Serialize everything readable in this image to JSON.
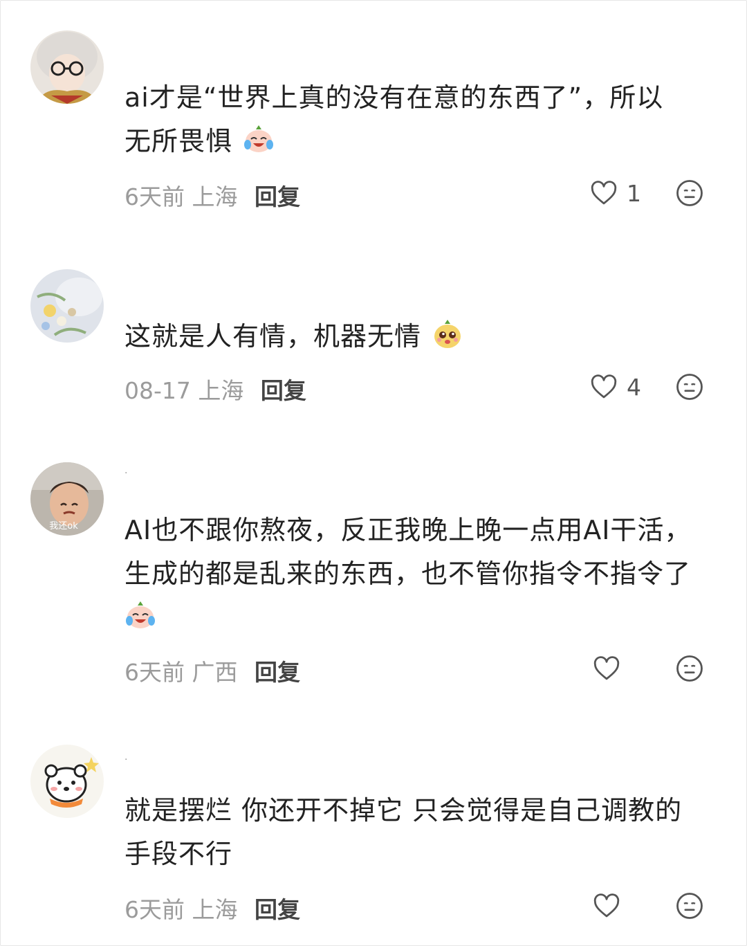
{
  "comments": [
    {
      "username": "",
      "text_lines": [
        "ai才是“世界上真的没有在意的东西了”，所以",
        "无所畏惧"
      ],
      "time": "6天前",
      "location": "上海",
      "reply_label": "回复",
      "likes": "1",
      "emoji_icon": "crying-laughing-emoji-icon"
    },
    {
      "username": "",
      "text_lines": [
        "这就是人有情，机器无情"
      ],
      "time": "08-17",
      "location": "上海",
      "reply_label": "回复",
      "likes": "4",
      "emoji_icon": "puppy-eyes-emoji-icon"
    },
    {
      "username": ".",
      "avatar_text": "我还ok",
      "text_lines": [
        "AI也不跟你熬夜，反正我晚上晚一点用AI干活，",
        "生成的都是乱来的东西，也不管你指令不指令了"
      ],
      "time": "6天前",
      "location": "广西",
      "reply_label": "回复",
      "likes": "",
      "emoji_icon": "crying-laughing-emoji-icon"
    },
    {
      "username": ".",
      "text_lines": [
        "就是摆烂 你还开不掉它 只会觉得是自己调教的",
        "手段不行"
      ],
      "time": "6天前",
      "location": "上海",
      "reply_label": "回复",
      "likes": "",
      "emoji_icon": ""
    }
  ],
  "icons": {
    "like": "heart-outline-icon",
    "dislike": "meh-face-icon"
  },
  "colors": {
    "meta_text": "#9b9b9b",
    "content_text": "#222222",
    "icon_stroke": "#555555"
  }
}
